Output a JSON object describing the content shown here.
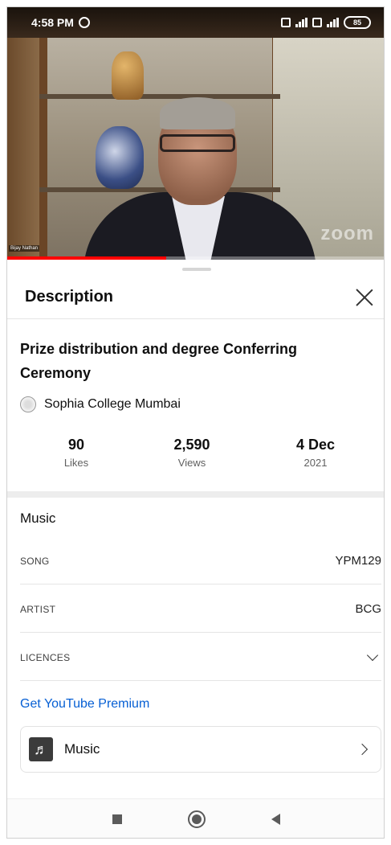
{
  "status_bar": {
    "time": "4:58 PM",
    "battery": "85"
  },
  "video": {
    "watermark": "zoom",
    "speaker_tag": "Bijay Nathan",
    "progress_fraction": 0.42,
    "progress_color": "#ff0000"
  },
  "description": {
    "title": "Description",
    "video_title": "Prize distribution and degree Conferring Ceremony",
    "channel": "Sophia College Mumbai",
    "stats": [
      {
        "value": "90",
        "label": "Likes"
      },
      {
        "value": "2,590",
        "label": "Views"
      },
      {
        "value": "4 Dec",
        "label": "2021"
      }
    ]
  },
  "music": {
    "heading": "Music",
    "rows": [
      {
        "key": "SONG",
        "value": "YPM129"
      },
      {
        "key": "ARTIST",
        "value": "BCG"
      },
      {
        "key": "LICENCES",
        "value": ""
      }
    ],
    "premium_link": "Get YouTube Premium",
    "premium_link_color": "#065fd4",
    "card_label": "Music"
  },
  "icons": {
    "close": "close-icon",
    "music_note": "music-note-icon",
    "chevron_right": "chevron-right-icon",
    "chevron_down": "chevron-down-icon"
  }
}
